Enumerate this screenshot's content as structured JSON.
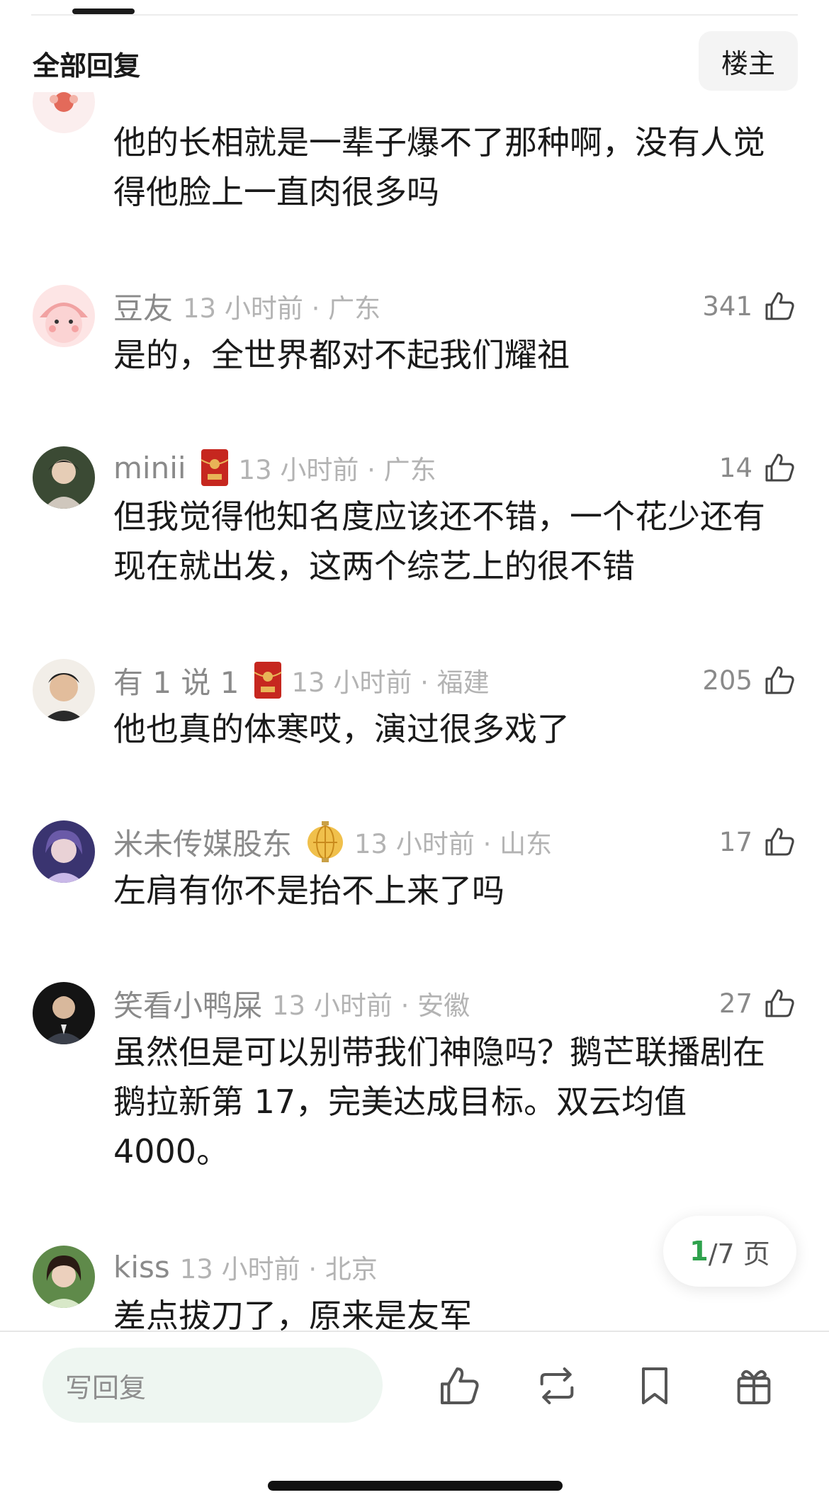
{
  "header": {
    "section_title": "全部回复",
    "op_button": "楼主"
  },
  "comments": [
    {
      "username": "",
      "time": "",
      "text": "他的长相就是一辈子爆不了那种啊，没有人觉得他脸上一直肉很多吗",
      "likes": ""
    },
    {
      "username": "豆友",
      "time": "13 小时前 · 广东",
      "text": "是的，全世界都对不起我们耀祖",
      "likes": "341"
    },
    {
      "username": "minii",
      "time": "13 小时前 · 广东",
      "text": "但我觉得他知名度应该还不错，一个花少还有现在就出发，这两个综艺上的很不错",
      "likes": "14"
    },
    {
      "username": "有 1 说 1",
      "time": "13 小时前 · 福建",
      "text": "他也真的体寒哎，演过很多戏了",
      "likes": "205"
    },
    {
      "username": "米未传媒股东",
      "time": "13 小时前 · 山东",
      "text": "左肩有你不是抬不上来了吗",
      "likes": "17"
    },
    {
      "username": "笑看小鸭屎",
      "time": "13 小时前 · 安徽",
      "text": "虽然但是可以别带我们神隐吗？鹅芒联播剧在鹅拉新第 17，完美达成目标。双云均值 4000。",
      "likes": "27"
    },
    {
      "username": "kiss",
      "time": "13 小时前 · 北京",
      "text": "差点拔刀了，原来是友军",
      "likes": ""
    }
  ],
  "pager": {
    "current": "1",
    "total": "/7 页"
  },
  "bottom_bar": {
    "reply_placeholder": "写回复",
    "icons": [
      "thumbs-up-icon",
      "repost-icon",
      "bookmark-icon",
      "gift-icon"
    ]
  },
  "colors": {
    "accent": "#2fa24d",
    "meta_gray": "#b3b3b3",
    "name_gray": "#8a8a8a",
    "input_bg": "#eef6f1"
  }
}
